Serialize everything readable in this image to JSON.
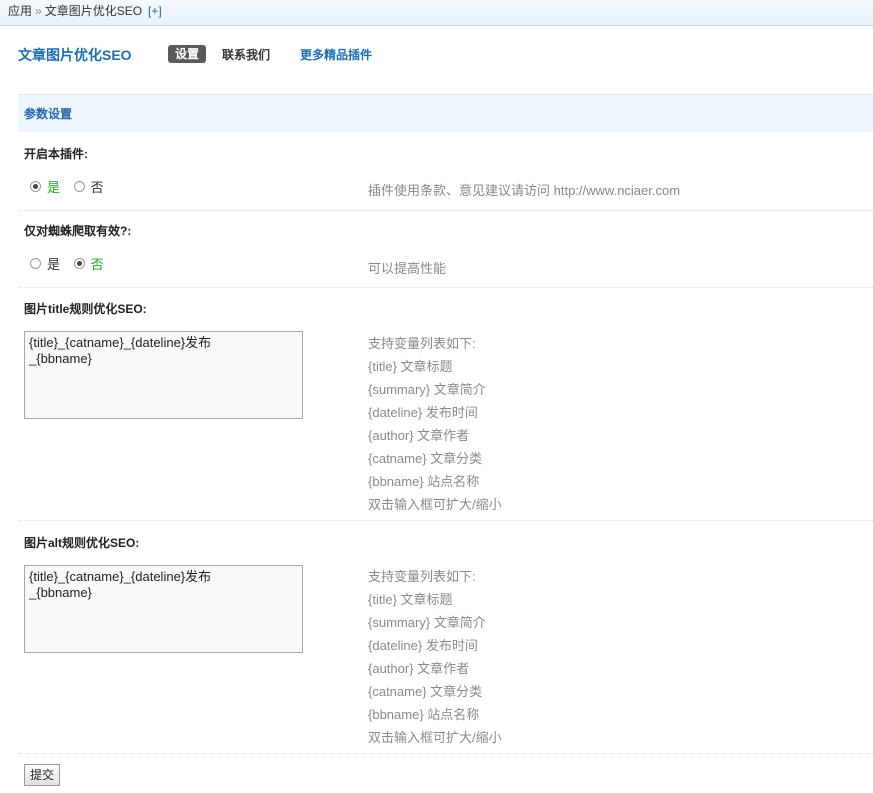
{
  "breadcrumb": {
    "root": "应用",
    "separator": "»",
    "current": "文章图片优化SEO",
    "add": "[+]"
  },
  "header": {
    "title": "文章图片优化SEO",
    "tabs": [
      "设置",
      "联系我们",
      "更多精品插件"
    ]
  },
  "section": {
    "title": "参数设置"
  },
  "settings": [
    {
      "label": "开启本插件:",
      "options": [
        "是",
        "否"
      ],
      "selected": "是",
      "comment": "插件使用条款、意见建议请访问 http://www.nciaer.com"
    },
    {
      "label": "仅对蜘蛛爬取有效?:",
      "options": [
        "是",
        "否"
      ],
      "selected": "否",
      "comment": "可以提高性能"
    },
    {
      "label": "图片title规则优化SEO:",
      "value": "{title}_{catname}_{dateline}发布\n_{bbname}",
      "comment_lines": [
        "支持变量列表如下:",
        "{title} 文章标题",
        "{summary} 文章简介",
        "{dateline} 发布时间",
        "{author} 文章作者",
        "{catname} 文章分类",
        "{bbname} 站点名称",
        "双击输入框可扩大/缩小"
      ]
    },
    {
      "label": "图片alt规则优化SEO:",
      "value": "{title}_{catname}_{dateline}发布\n_{bbname}",
      "comment_lines": [
        "支持变量列表如下:",
        "{title} 文章标题",
        "{summary} 文章简介",
        "{dateline} 发布时间",
        "{author} 文章作者",
        "{catname} 文章分类",
        "{bbname} 站点名称",
        "双击输入框可扩大/缩小"
      ]
    }
  ],
  "submit_label": "提交"
}
